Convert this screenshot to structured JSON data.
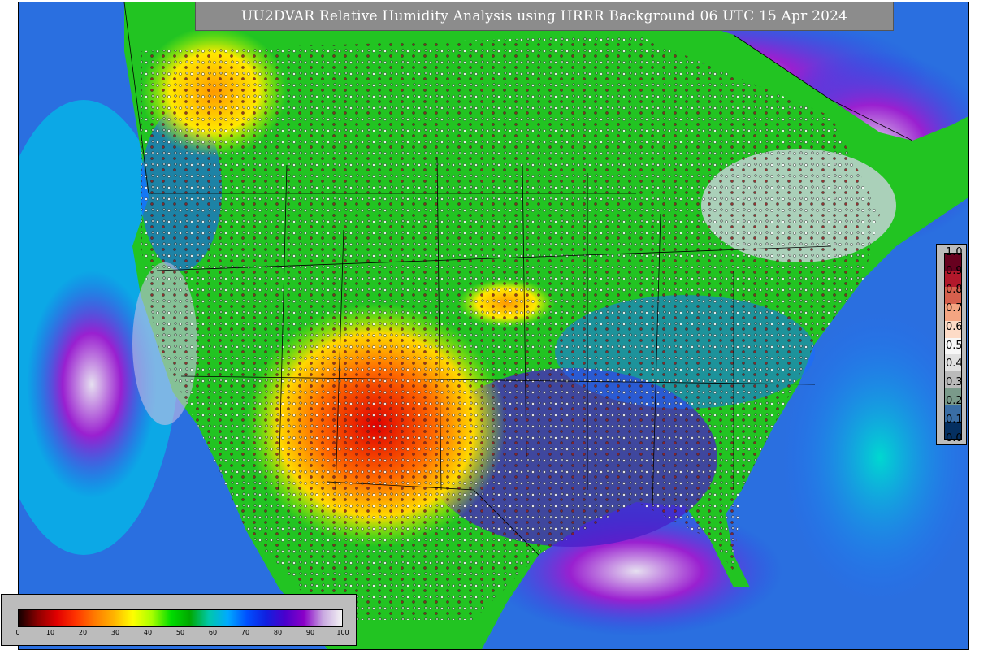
{
  "title": "UU2DVAR Relative Humidity Analysis using HRRR Background 06 UTC 15 Apr 2024",
  "colorbar_main": {
    "ticks": [
      "0",
      "10",
      "20",
      "30",
      "40",
      "50",
      "60",
      "70",
      "80",
      "90",
      "100"
    ],
    "colors": [
      "#120000",
      "#8b0000",
      "#e10000",
      "#ff3300",
      "#ff7a00",
      "#ffb300",
      "#ffff00",
      "#a8ff00",
      "#00dd00",
      "#00a800",
      "#00c8aa",
      "#00aaff",
      "#0050ff",
      "#1020e0",
      "#4a00cc",
      "#8a00c8",
      "#c8a8e0",
      "#f4f4f4"
    ]
  },
  "colorbar_obs": {
    "ticks": [
      "1.0",
      "0.9",
      "0.8",
      "0.7",
      "0.6",
      "0.5",
      "0.4",
      "0.3",
      "0.2",
      "0.1",
      "0.0"
    ],
    "colors": [
      "#67001f",
      "#b2182b",
      "#d6604d",
      "#f4a582",
      "#fddbc7",
      "#f7f7f7",
      "#e0e0e0",
      "#bababa",
      "#7a9a8a",
      "#3a6ea5",
      "#053061"
    ]
  },
  "palette": {
    "ocean_blue": "#2a6fe0",
    "land_green": "#22c422",
    "dry_red": "#e01a00",
    "moist_purple": "#7a10c8",
    "saturated_white": "#e8e8f0",
    "border_black": "#000000"
  }
}
